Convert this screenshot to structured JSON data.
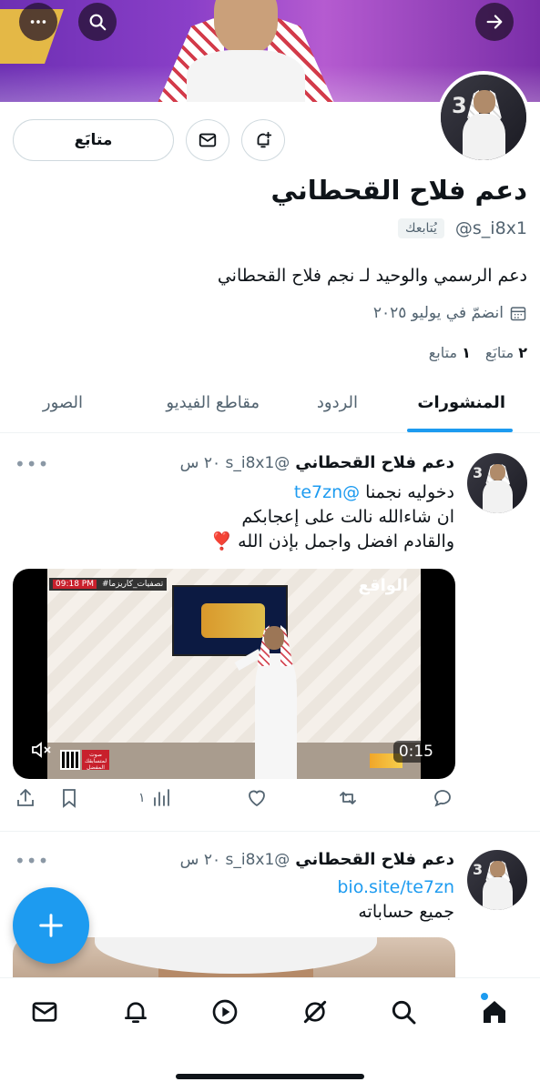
{
  "header": {
    "back_icon": "arrow-right-icon",
    "search_icon": "search-icon",
    "more_icon": "more-horizontal-icon"
  },
  "profile": {
    "name": "دعم فلاح القحطاني",
    "handle": "@s_i8x1",
    "follows_you": "يُتابعك",
    "bio": "دعم الرسمي والوحيد لـ نجم فلاح القحطاني",
    "joined": "انضمّ في يوليو ٢٠٢٥",
    "following_count": "٢",
    "following_label": "متابَع",
    "followers_count": "١",
    "followers_label": "متابع",
    "follow_button": "متابَع"
  },
  "tabs": [
    "المنشورات",
    "الردود",
    "مقاطع الفيديو",
    "الصور"
  ],
  "posts": [
    {
      "name": "دعم فلاح القحطاني",
      "meta": "@s_i8x1 ٢٠ س",
      "line1_text": "دخوليه نجمنا ",
      "line1_link": "@te7zn",
      "line2": "ان شاءالله نالت على إعجابكم",
      "line3": "والقادم افضل واجمل بإذن الله ❣️",
      "video": {
        "brand": "الواقع",
        "ticker_time": "09:18 PM",
        "ticker_text": "#تصفيات_كاريزما",
        "vote_text": "صوت لمتسابقك المفضل",
        "duration": "0:15"
      },
      "views": "١"
    },
    {
      "name": "دعم فلاح القحطاني",
      "meta": "@s_i8x1 ٢٠ س",
      "link": "bio.site/te7zn",
      "line2": "جميع حساباته"
    }
  ],
  "more_dots": "•••",
  "bottom_nav": [
    "home-icon",
    "search-icon",
    "grok-icon",
    "video-icon",
    "notifications-icon",
    "messages-icon"
  ],
  "colors": {
    "accent": "#1d9bf0",
    "text": "#0f1419",
    "muted": "#536471",
    "border": "#cfd9de"
  }
}
